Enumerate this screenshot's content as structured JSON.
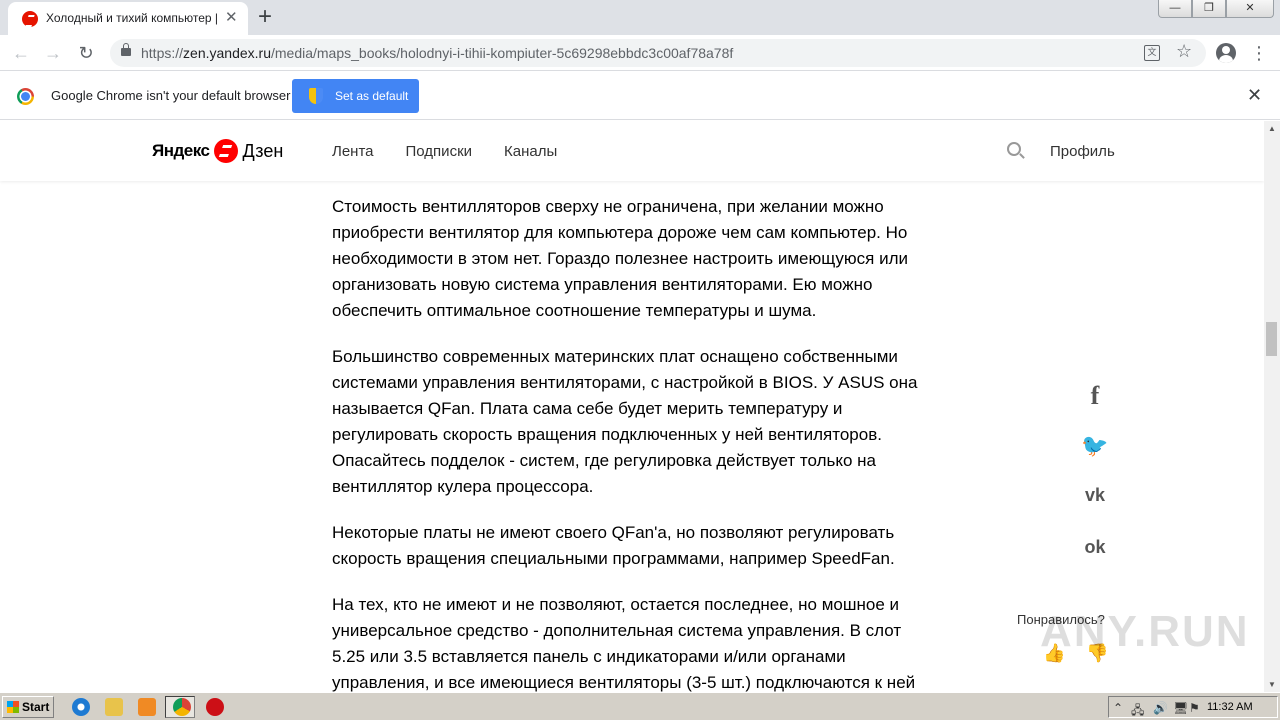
{
  "browser": {
    "tab": {
      "title": "Холодный и тихий компьютер | Ка",
      "close_glyph": "✕"
    },
    "new_tab_glyph": "+",
    "window_controls": [
      "—",
      "❐",
      "✕"
    ],
    "url_prefix": "https://",
    "url_host": "zen.yandex.ru",
    "url_path": "/media/maps_books/holodnyi-i-tihii-kompiuter-5c69298ebbdc3c00af78a78f",
    "nav": {
      "back": "←",
      "forward": "→",
      "reload": "↻"
    },
    "star_glyph": "☆",
    "menu_glyph": "⋮",
    "translate_glyph": "文"
  },
  "infobar": {
    "message": "Google Chrome isn't your default browser",
    "button_label": "Set as default",
    "close_glyph": "✕"
  },
  "site": {
    "brand_yandex": "Яндекс",
    "brand_zen": "Дзен",
    "nav": [
      "Лента",
      "Подписки",
      "Каналы"
    ],
    "profile_label": "Профиль"
  },
  "article": {
    "paragraphs": [
      "Стоимость вентилляторов сверху не ограничена, при желании можно приобрести вентилятор для компьютера дороже чем сам компьютер. Но необходимости в этом нет. Гораздо полезнее настроить имеющуюся или организовать новую система управления вентиляторами. Ею можно обеспечить оптимальное соотношение температуры и шума.",
      "Большинство современных материнских плат оснащено собственными системами управления вентиляторами, с настройкой в BIOS. У ASUS она называется QFan. Плата сама себе будет мерить температуру и регулировать скорость вращения подключенных у ней вентиляторов. Опасайтесь подделок - систем, где регулировка действует только на вентиллятор кулера процессора.",
      "Некоторые платы не имеют своего QFan'а, но позволяют регулировать скорость вращения специальными программами, например SpeedFan.",
      "На тех, кто не имеют и не позволяют, остается последнее, но мошное и универсальное средство - дополнительная система управления. В слот 5.25 или 3.5 вставляется панель с индикаторами и/или органами управления, и все имеющиеся вентиляторы (3-5 шт.) подключаются к ней"
    ]
  },
  "share": {
    "facebook": "f",
    "twitter": "🐦",
    "vk": "vk",
    "ok": "ok"
  },
  "feedback": {
    "question": "Понравилось?",
    "like_glyph": "👍",
    "dislike_glyph": "👎"
  },
  "watermark": "ANY.RUN",
  "scrollbar": {
    "up": "▲",
    "down": "▼"
  },
  "taskbar": {
    "start_label": "Start",
    "tray_glyphs": [
      "⌃",
      "🖧",
      "🔊",
      "🖥",
      "⚑"
    ],
    "clock": "11:32 AM"
  }
}
